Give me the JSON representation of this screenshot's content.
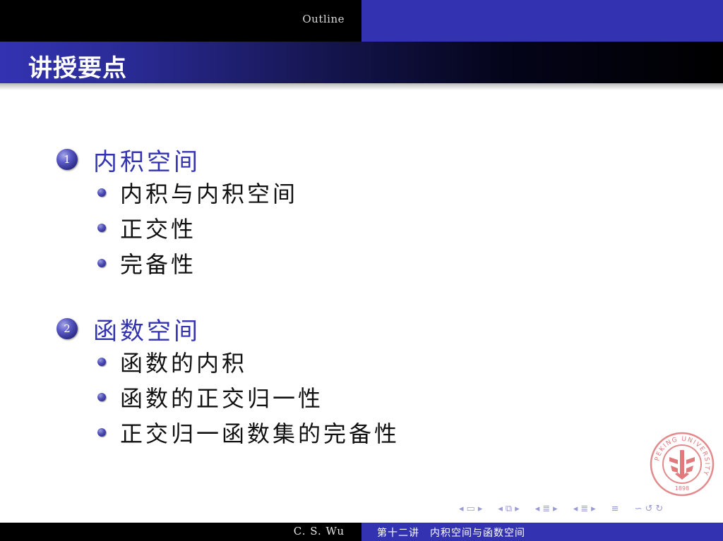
{
  "header": {
    "section_nav": "Outline"
  },
  "frame": {
    "title": "讲授要点"
  },
  "sections": [
    {
      "number": "1",
      "title": "内积空间",
      "items": [
        "内积与内积空间",
        "正交性",
        "完备性"
      ]
    },
    {
      "number": "2",
      "title": "函数空间",
      "items": [
        "函数的内积",
        "函数的正交归一性",
        "正交归一函数集的完备性"
      ]
    }
  ],
  "logo": {
    "ring_text": "PEKING UNIVERSITY",
    "year": "1898",
    "color": "#d9383a"
  },
  "nav_icons": [
    "nav-frame-prev-icon",
    "nav-frame-icon",
    "nav-frame-next-icon",
    "nav-subsection-prev-icon",
    "nav-subsection-icon",
    "nav-subsection-next-icon",
    "nav-section-prev-icon",
    "nav-section-icon",
    "nav-section-next-icon",
    "nav-part-prev-icon",
    "nav-part-icon",
    "nav-part-next-icon",
    "nav-doc-icon",
    "nav-search-icon",
    "nav-back-icon",
    "nav-forward-icon"
  ],
  "footer": {
    "author": "C. S. Wu",
    "short_title": "第十二讲　内积空间与函数空间"
  },
  "colors": {
    "theme_blue": "#3333b2",
    "background": "#ffffff"
  }
}
